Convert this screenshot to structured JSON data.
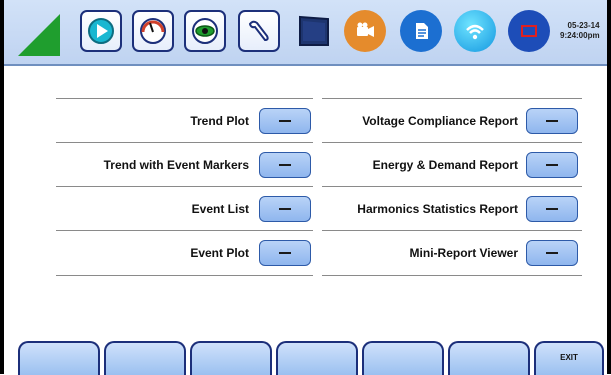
{
  "datetime": {
    "date": "05-23-14",
    "time": "9:24:00pm"
  },
  "toolbar": {
    "icons": [
      "play-icon",
      "gauge-icon",
      "eye-icon",
      "wrench-icon",
      "monitor-icon",
      "camera-icon",
      "document-icon",
      "wifi-icon",
      "screen-icon"
    ]
  },
  "reports": {
    "left": [
      {
        "label": "Trend Plot",
        "button": ""
      },
      {
        "label": "Trend with Event Markers",
        "button": ""
      },
      {
        "label": "Event List",
        "button": ""
      },
      {
        "label": "Event Plot",
        "button": ""
      }
    ],
    "right": [
      {
        "label": "Voltage Compliance Report",
        "button": ""
      },
      {
        "label": "Energy & Demand Report",
        "button": ""
      },
      {
        "label": "Harmonics Statistics Report",
        "button": ""
      },
      {
        "label": "Mini-Report Viewer",
        "button": ""
      }
    ]
  },
  "bottom": {
    "tabs": [
      "",
      "",
      "",
      "",
      "",
      "",
      ""
    ],
    "exit_label": "EXIT"
  },
  "colors": {
    "accent": "#1f9e2e",
    "button": "#a9c8f4",
    "orange": "#e58b2c",
    "blue": "#1c6fd1"
  }
}
